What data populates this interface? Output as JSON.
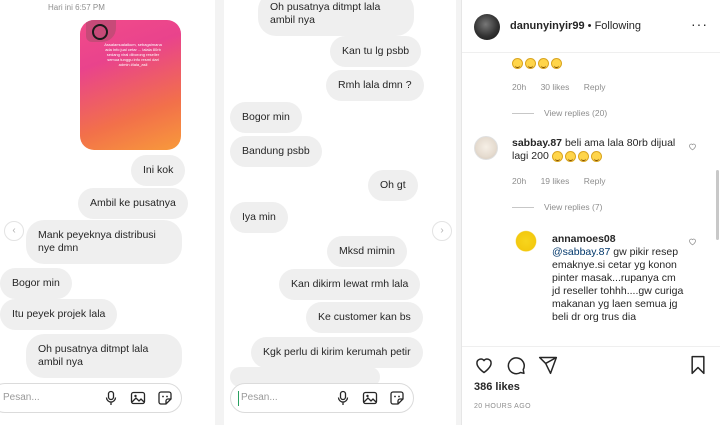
{
  "chat_left": {
    "date_label": "Hari ini 6:57 PM",
    "story_caption": "Assalamualaikum, sebagaimana ada info jual cetar ... lalala 80rb sedang viral diborong reseller semua tunggu info resmi dari admin #lala_asli",
    "messages": [
      {
        "text": "Ini kok"
      },
      {
        "text": "Ambil ke pusatnya"
      },
      {
        "text": "Mank peyeknya distribusi nye dmn"
      },
      {
        "text": "Bogor min"
      },
      {
        "text": "Itu peyek projek lala"
      },
      {
        "text": "Oh pusatnya ditmpt lala ambil nya"
      }
    ],
    "composer_placeholder": "Pesan..."
  },
  "chat_right": {
    "messages": [
      {
        "text": "Oh pusatnya ditmpt lala ambil nya"
      },
      {
        "text": "Kan tu lg psbb"
      },
      {
        "text": "Rmh lala dmn ?"
      },
      {
        "text": "Bogor min"
      },
      {
        "text": "Bandung psbb"
      },
      {
        "text": "Oh gt"
      },
      {
        "text": "Iya min"
      },
      {
        "text": "Mksd mimin"
      },
      {
        "text": "Kan dikirm lewat rmh lala"
      },
      {
        "text": "Ke customer kan bs"
      },
      {
        "text": "Kgk perlu di kirim kerumah petir"
      }
    ],
    "composer_placeholder": "Pesan..."
  },
  "post": {
    "username": "danunyinyir99",
    "separator": "•",
    "follow_status": "Following",
    "comment0": {
      "emoji_count": 4,
      "time": "20h",
      "likes": "30 likes",
      "reply": "Reply",
      "view_replies": "View replies (20)"
    },
    "comment1": {
      "username": "sabbay.87",
      "text": "beli ama lala 80rb dijual lagi 200",
      "emoji_count": 4,
      "time": "20h",
      "likes": "19 likes",
      "reply": "Reply",
      "view_replies": "View replies (7)"
    },
    "comment2": {
      "username": "annamoes08",
      "mention": "@sabbay.87",
      "text": "gw pikir resep emaknye.si cetar yg konon pinter masak...rupanya cm jd reseller tohhh....gw curiga makanan yg laen semua jg beli dr org trus dia"
    },
    "likes_count": "386 likes",
    "time_ago": "20 HOURS AGO"
  }
}
